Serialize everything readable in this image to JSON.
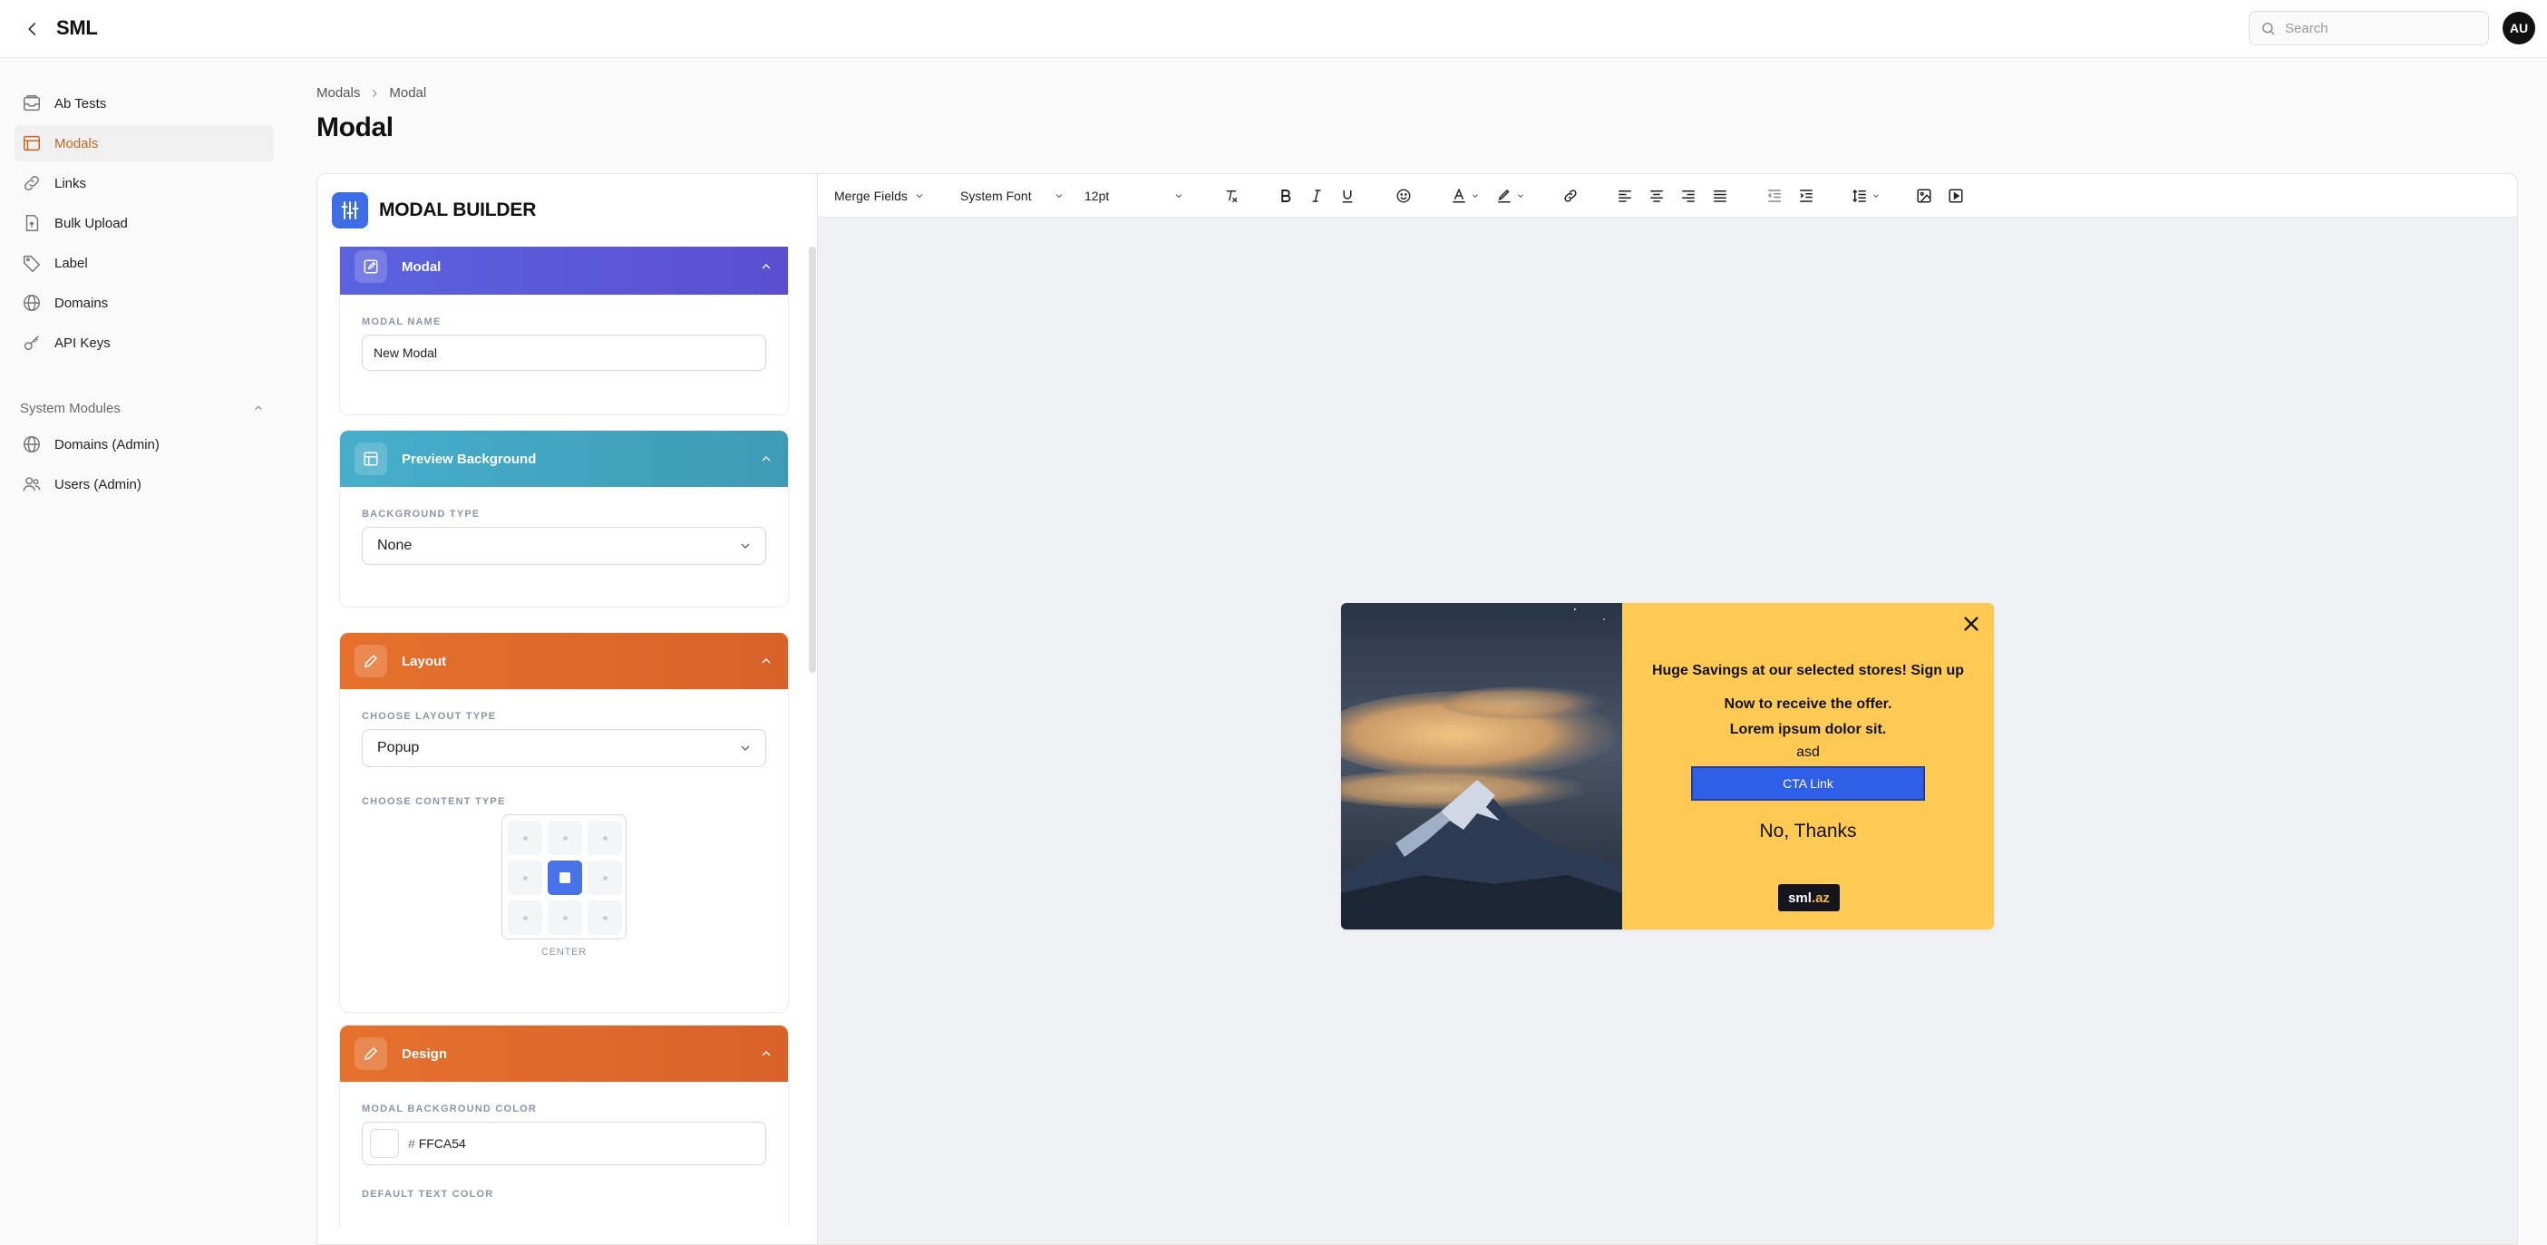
{
  "header": {
    "app_title": "SML",
    "search_placeholder": "Search",
    "avatar_initials": "AU"
  },
  "sidebar": {
    "items": [
      {
        "label": "Ab Tests",
        "icon": "box-icon",
        "active": false
      },
      {
        "label": "Modals",
        "icon": "browser-window-icon",
        "active": true
      },
      {
        "label": "Links",
        "icon": "link-icon",
        "active": false
      },
      {
        "label": "Bulk Upload",
        "icon": "upload-icon",
        "active": false
      },
      {
        "label": "Label",
        "icon": "tag-icon",
        "active": false
      },
      {
        "label": "Domains",
        "icon": "globe-icon",
        "active": false
      },
      {
        "label": "API Keys",
        "icon": "key-icon",
        "active": false
      }
    ],
    "system_modules": {
      "label": "System Modules",
      "items": [
        {
          "label": "Domains (Admin)",
          "icon": "globe-icon"
        },
        {
          "label": "Users (Admin)",
          "icon": "users-icon"
        }
      ]
    }
  },
  "breadcrumb": [
    "Modals",
    "Modal"
  ],
  "page_title": "Modal",
  "builder": {
    "title": "MODAL BUILDER",
    "sections": {
      "modal": {
        "title": "Modal",
        "color": "#5b5bd6",
        "field_label": "MODAL NAME",
        "field_value": "New Modal"
      },
      "preview_background": {
        "title": "Preview Background",
        "color": "#4aa8c4",
        "field_label": "BACKGROUND TYPE",
        "field_value": "None"
      },
      "layout": {
        "title": "Layout",
        "color": "#e06a2c",
        "layout_label": "CHOOSE LAYOUT TYPE",
        "layout_value": "Popup",
        "content_label": "CHOOSE CONTENT TYPE",
        "content_selected": "CENTER"
      },
      "design": {
        "title": "Design",
        "color": "#e06a2c",
        "bg_label": "MODAL BACKGROUND COLOR",
        "bg_hash": "#",
        "bg_value": "FFCA54",
        "text_color_label": "DEFAULT TEXT COLOR"
      }
    }
  },
  "toolbar": {
    "merge_fields": "Merge Fields",
    "font_family": "System Font",
    "font_size": "12pt"
  },
  "preview": {
    "background_color": "#FFCA54",
    "headline": "Huge Savings at our selected stores! Sign up Now to receive the offer.",
    "lorem": "Lorem ipsum dolor sit.",
    "small_text": "asd",
    "cta_label": "CTA Link",
    "decline_label": "No, Thanks",
    "brand_main": "sml",
    "brand_suffix": ".az"
  }
}
